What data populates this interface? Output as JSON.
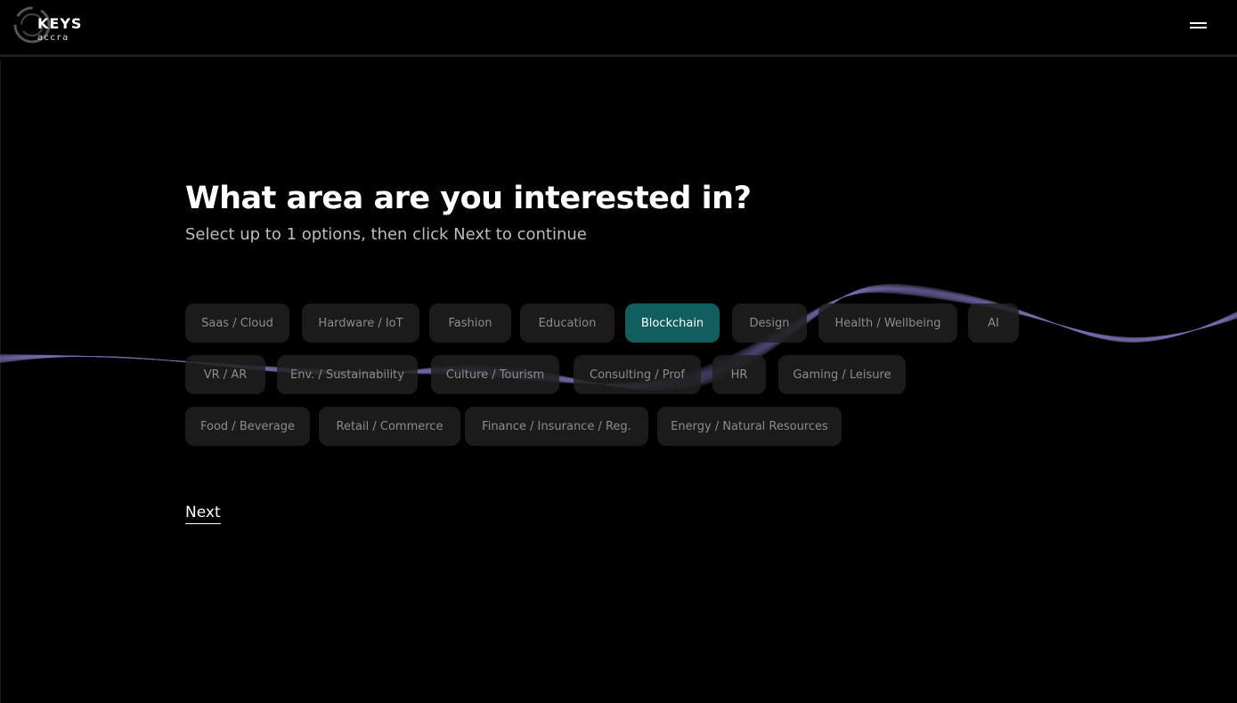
{
  "brand": {
    "name": "KEYS",
    "sub": "accra"
  },
  "question": {
    "title": "What area are you interested in?",
    "subtitle": "Select up to 1 options, then click Next to continue"
  },
  "options": [
    {
      "label": "Saas / Cloud",
      "selected": false
    },
    {
      "label": "Hardware / IoT",
      "selected": false
    },
    {
      "label": "Fashion",
      "selected": false
    },
    {
      "label": "Education",
      "selected": false
    },
    {
      "label": "Blockchain",
      "selected": true
    },
    {
      "label": "Design",
      "selected": false
    },
    {
      "label": "Health / Wellbeing",
      "selected": false
    },
    {
      "label": "AI",
      "selected": false
    },
    {
      "label": "VR / AR",
      "selected": false
    },
    {
      "label": "Env. / Sustainability",
      "selected": false
    },
    {
      "label": "Culture / Tourism",
      "selected": false
    },
    {
      "label": "Consulting / Prof",
      "selected": false
    },
    {
      "label": "HR",
      "selected": false
    },
    {
      "label": "Gaming / Leisure",
      "selected": false
    },
    {
      "label": "Food / Beverage",
      "selected": false
    },
    {
      "label": "Retail / Commerce",
      "selected": false
    },
    {
      "label": "Finance / Insurance / Reg.",
      "selected": false
    },
    {
      "label": "Energy / Natural Resources",
      "selected": false
    }
  ],
  "actions": {
    "next_label": "Next"
  },
  "colors": {
    "selected": "#115e5e",
    "chip": "#202020",
    "background": "#000000",
    "wave": "#7a6fb0"
  },
  "icons": {
    "menu": "hamburger-icon",
    "logo": "keys-logo-icon"
  }
}
